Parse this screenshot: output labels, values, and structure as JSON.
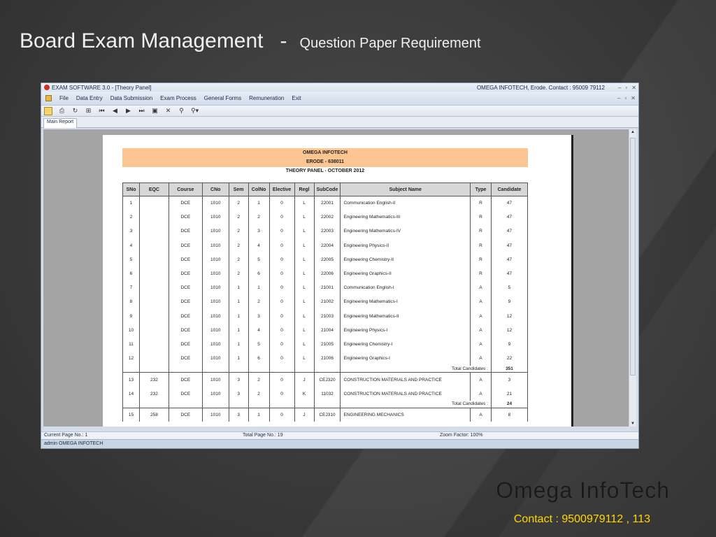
{
  "slide": {
    "title_main": "Board Exam Management",
    "title_dash": "-",
    "title_sub": "Question Paper Requirement",
    "brand": "Omega  InfoTech",
    "contact": "Contact : 9500979112 , 113"
  },
  "window": {
    "title": "EXAM SOFTWARE 3.0 - [Theory Panel]",
    "company": "OMEGA INFOTECH, Erode. Contact : 95009 79112",
    "controls": [
      "–",
      "▫",
      "✕"
    ],
    "menu": [
      "File",
      "Data Entry",
      "Data Submission",
      "Exam Process",
      "General Forms",
      "Remuneration",
      "Exit"
    ],
    "toolbar_icons": [
      "export-icon",
      "print-icon",
      "refresh-icon",
      "tree-icon",
      "first-page-icon",
      "prev-page-icon",
      "next-page-icon",
      "last-page-icon",
      "goto-page-icon",
      "stop-icon",
      "search-icon",
      "zoom-icon"
    ],
    "tab": "Main Report"
  },
  "report": {
    "company": "OMEGA INFOTECH",
    "place": "ERODE - 638011",
    "subtitle": "THEORY PANEL - OCTOBER 2012",
    "columns": [
      "SNo",
      "EQC",
      "Course",
      "CNo",
      "Sem",
      "ColNo",
      "Elective",
      "Regl",
      "SubCode",
      "Subject Name",
      "Type",
      "Candidate"
    ],
    "groups": [
      {
        "rows": [
          [
            "1",
            "",
            "DCE",
            "1010",
            "2",
            "1",
            "0",
            "L",
            "22001",
            "Communication English-II",
            "R",
            "47"
          ],
          [
            "2",
            "",
            "DCE",
            "1010",
            "2",
            "2",
            "0",
            "L",
            "22002",
            "Engineering Mathematics-III",
            "R",
            "47"
          ],
          [
            "3",
            "",
            "DCE",
            "1010",
            "2",
            "3",
            "0",
            "L",
            "22003",
            "Engineering Mathematics-IV",
            "R",
            "47"
          ],
          [
            "4",
            "",
            "DCE",
            "1010",
            "2",
            "4",
            "0",
            "L",
            "22004",
            "Engineering Physics-II",
            "R",
            "47"
          ],
          [
            "5",
            "",
            "DCE",
            "1010",
            "2",
            "5",
            "0",
            "L",
            "22005",
            "Engineering Chemistry-II",
            "R",
            "47"
          ],
          [
            "6",
            "",
            "DCE",
            "1010",
            "2",
            "6",
            "0",
            "L",
            "22006",
            "Engineering Graphics-II",
            "R",
            "47"
          ],
          [
            "7",
            "",
            "DCE",
            "1010",
            "1",
            "1",
            "0",
            "L",
            "21001",
            "Communication English-I",
            "A",
            "5"
          ],
          [
            "8",
            "",
            "DCE",
            "1010",
            "1",
            "2",
            "0",
            "L",
            "21002",
            "Engineering Mathematics-I",
            "A",
            "9"
          ],
          [
            "9",
            "",
            "DCE",
            "1010",
            "1",
            "3",
            "0",
            "L",
            "21003",
            "Engineering Mathematics-II",
            "A",
            "12"
          ],
          [
            "10",
            "",
            "DCE",
            "1010",
            "1",
            "4",
            "0",
            "L",
            "21004",
            "Engineering Physics-I",
            "A",
            "12"
          ],
          [
            "11",
            "",
            "DCE",
            "1010",
            "1",
            "5",
            "0",
            "L",
            "21005",
            "Engineering Chemistry-I",
            "A",
            "9"
          ],
          [
            "12",
            "",
            "DCE",
            "1010",
            "1",
            "6",
            "0",
            "L",
            "21006",
            "Engineering Graphics-I",
            "A",
            "22"
          ]
        ],
        "total_label": "Total Candidates :",
        "total": "351"
      },
      {
        "rows": [
          [
            "13",
            "232",
            "DCE",
            "1010",
            "3",
            "2",
            "0",
            "J",
            "CEJ320",
            "CONSTRUCTION MATERIALS AND PRACTICE",
            "A",
            "3"
          ],
          [
            "14",
            "232",
            "DCE",
            "1010",
            "3",
            "2",
            "0",
            "K",
            "11032",
            "CONSTRUCTION MATERIALS AND PRACTICE",
            "A",
            "21"
          ]
        ],
        "total_label": "Total Candidates :",
        "total": "24"
      },
      {
        "rows": [
          [
            "15",
            "258",
            "DCE",
            "1010",
            "3",
            "1",
            "0",
            "J",
            "CEJ310",
            "ENGINEERING MECHANICS",
            "A",
            "8"
          ]
        ],
        "total_label": "",
        "total": ""
      }
    ]
  },
  "status": {
    "current_page": "Current Page No.: 1",
    "total_page": "Total Page No.: 19",
    "zoom": "Zoom Factor: 100%",
    "user": "admin   OMEGA INFOTECH"
  }
}
